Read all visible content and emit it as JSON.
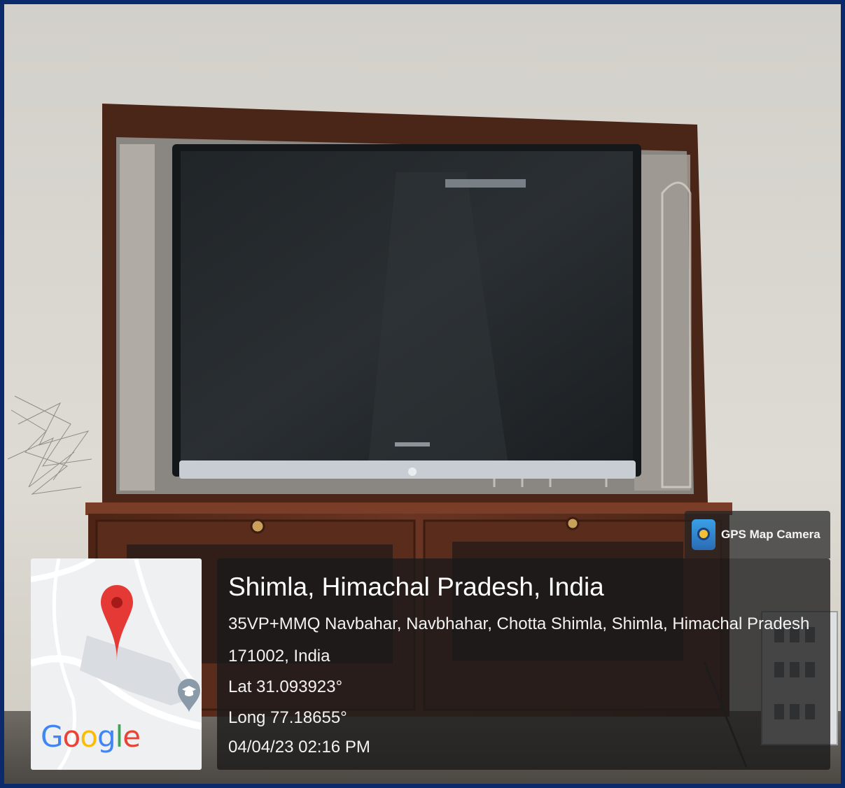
{
  "gps_badge": {
    "label": "GPS Map Camera",
    "icon": "gps-map-camera-app-icon"
  },
  "location": {
    "title": "Shimla, Himachal Pradesh, India",
    "address_line1": "35VP+MMQ Navbahar, Navbhahar, Chotta Shimla, Shimla, Himachal Pradesh",
    "address_line2": "171002, India",
    "latitude": "Lat 31.093923°",
    "longitude": "Long 77.18655°",
    "timestamp": "04/04/23 02:16 PM"
  },
  "map": {
    "logo_parts": [
      "G",
      "o",
      "o",
      "g",
      "l",
      "e"
    ],
    "pin_icon": "map-pin-icon",
    "poi_icon": "school-poi-icon",
    "pin_color": "#e53935",
    "poi_color": "#8a9aa8"
  },
  "colors": {
    "frame_border": "#0b2a6b",
    "wall": "#dcd9d2",
    "cabinet_wood": "#5b2e1d",
    "tv_screen": "#1e2327"
  }
}
